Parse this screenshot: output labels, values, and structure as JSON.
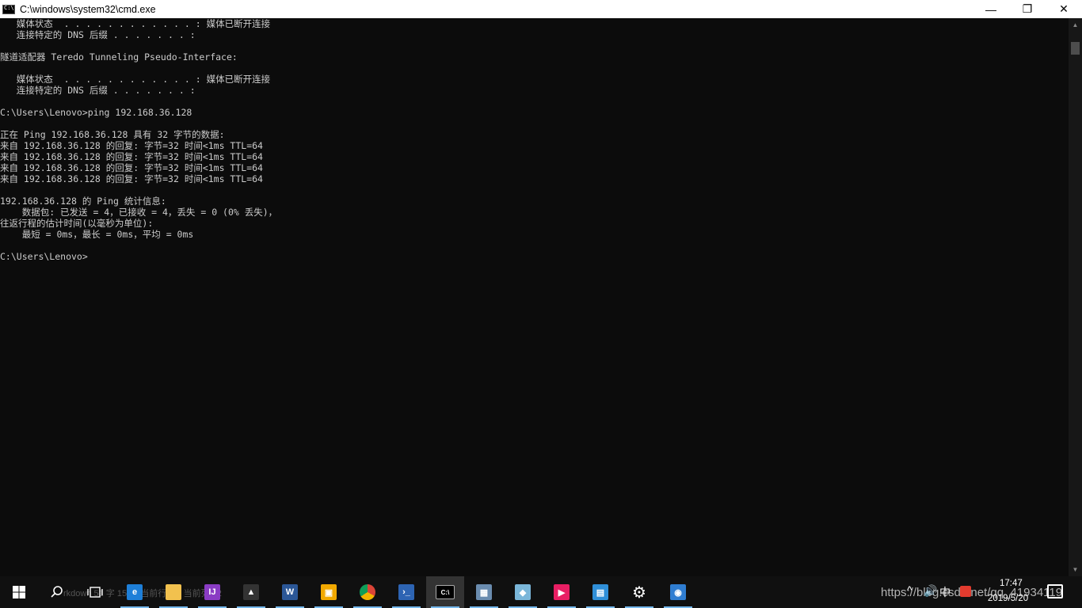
{
  "window": {
    "title": "C:\\windows\\system32\\cmd.exe",
    "controls": {
      "minimize": "—",
      "maximize": "❐",
      "close": "✕"
    }
  },
  "console": {
    "lines": [
      "   媒体状态  . . . . . . . . . . . . : 媒体已断开连接",
      "   连接特定的 DNS 后缀 . . . . . . . :",
      "",
      "隧道适配器 Teredo Tunneling Pseudo-Interface:",
      "",
      "   媒体状态  . . . . . . . . . . . . : 媒体已断开连接",
      "   连接特定的 DNS 后缀 . . . . . . . :",
      "",
      "C:\\Users\\Lenovo>ping 192.168.36.128",
      "",
      "正在 Ping 192.168.36.128 具有 32 字节的数据:",
      "来自 192.168.36.128 的回复: 字节=32 时间<1ms TTL=64",
      "来自 192.168.36.128 的回复: 字节=32 时间<1ms TTL=64",
      "来自 192.168.36.128 的回复: 字节=32 时间<1ms TTL=64",
      "来自 192.168.36.128 的回复: 字节=32 时间<1ms TTL=64",
      "",
      "192.168.36.128 的 Ping 统计信息:",
      "    数据包: 已发送 = 4，已接收 = 4，丢失 = 0 (0% 丢失)，",
      "往返行程的估计时间(以毫秒为单位):",
      "    最短 = 0ms，最长 = 0ms，平均 = 0ms",
      "",
      "C:\\Users\\Lenovo>"
    ]
  },
  "taskbar": {
    "search_ghost_text": "rkdown   51 字   15 行   当前行 15, 当前列 12",
    "apps": [
      {
        "name": "edge",
        "icon": "edge-icon",
        "glyph": "e",
        "color": "#1e7fd8"
      },
      {
        "name": "file-explorer",
        "icon": "folder-icon",
        "glyph": "",
        "color": "#f2c14e"
      },
      {
        "name": "intellij",
        "icon": "intellij-icon",
        "glyph": "IJ",
        "color": "#8a3cc4"
      },
      {
        "name": "photos",
        "icon": "photos-icon",
        "glyph": "▲",
        "color": "#333333"
      },
      {
        "name": "word",
        "icon": "word-icon",
        "glyph": "W",
        "color": "#2b5797"
      },
      {
        "name": "vmware",
        "icon": "vmware-icon",
        "glyph": "▣",
        "color": "#f2a900"
      },
      {
        "name": "chrome",
        "icon": "chrome-icon",
        "glyph": "●",
        "color": "#db4437"
      },
      {
        "name": "powershell",
        "icon": "powershell-icon",
        "glyph": "›_",
        "color": "#2d64b3"
      },
      {
        "name": "cmd",
        "icon": "cmd-icon",
        "glyph": "C:\\",
        "color": "#000000"
      },
      {
        "name": "control-panel",
        "icon": "control-panel-icon",
        "glyph": "▦",
        "color": "#6a8caf"
      },
      {
        "name": "notes",
        "icon": "notes-icon",
        "glyph": "◆",
        "color": "#7ab6d9"
      },
      {
        "name": "media-player",
        "icon": "media-player-icon",
        "glyph": "▶",
        "color": "#e81e63"
      },
      {
        "name": "remote-desktop",
        "icon": "remote-desktop-icon",
        "glyph": "▤",
        "color": "#2f8fd8"
      },
      {
        "name": "settings",
        "icon": "gear-icon",
        "glyph": "⚙",
        "color": "#101010"
      },
      {
        "name": "network",
        "icon": "globe-icon",
        "glyph": "◉",
        "color": "#2f7dd1"
      }
    ],
    "tray": {
      "ime": "中",
      "time": "17:47",
      "date": "2019/5/20"
    },
    "watermark": "https://blog.csdn.net/qq_41934119"
  }
}
